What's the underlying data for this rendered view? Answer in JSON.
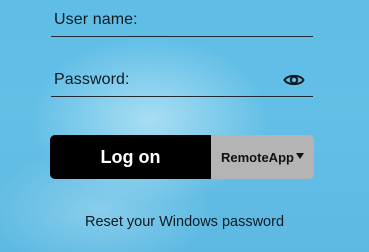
{
  "login_form": {
    "username_placeholder": "User name:",
    "username_value": "",
    "password_placeholder": "Password:",
    "password_value": "",
    "show_password_icon": "eye-icon",
    "logon_label": "Log on",
    "mode_selected": "RemoteApp",
    "mode_dropdown_icon": "triangle-down-icon",
    "reset_password_link": "Reset your Windows password"
  },
  "colors": {
    "background": "#63bfe6",
    "logon_button_bg": "#000000",
    "logon_button_text": "#ffffff",
    "mode_select_bg": "#b4b4b4",
    "text": "#0d1a22"
  }
}
